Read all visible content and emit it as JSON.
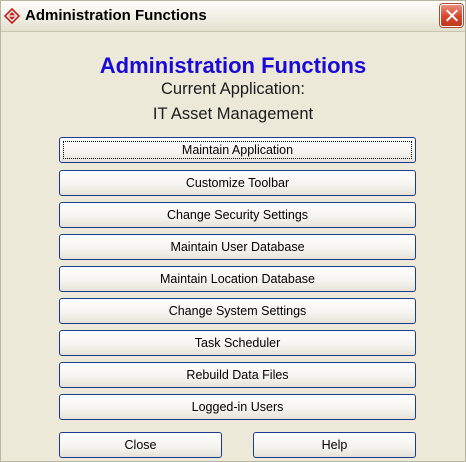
{
  "window": {
    "title": "Administration Functions",
    "icon": "app-diamond-icon",
    "close_icon": "close-icon"
  },
  "header": {
    "heading": "Administration Functions",
    "line1": "Current Application:",
    "line2": "IT Asset Management"
  },
  "menu": {
    "buttons": [
      {
        "label": "Maintain Application"
      },
      {
        "label": "Customize Toolbar"
      },
      {
        "label": "Change Security Settings"
      },
      {
        "label": "Maintain User Database"
      },
      {
        "label": "Maintain Location Database"
      },
      {
        "label": "Change System Settings"
      },
      {
        "label": "Task Scheduler"
      },
      {
        "label": "Rebuild Data Files"
      },
      {
        "label": "Logged-in Users"
      }
    ]
  },
  "footer": {
    "close_label": "Close",
    "help_label": "Help"
  },
  "colors": {
    "heading": "#1a0ad8",
    "dialog_background": "#ece9d8",
    "button_border": "#1c3b8c",
    "close_button": "#d6462d"
  }
}
